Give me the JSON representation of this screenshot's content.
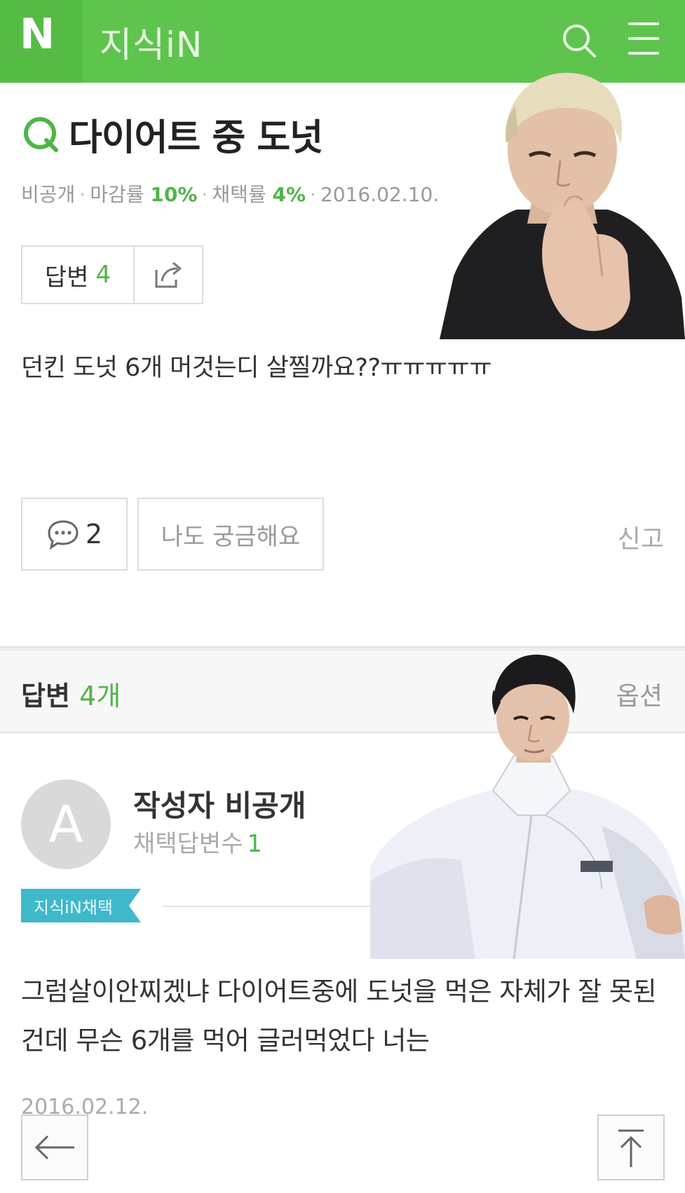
{
  "header": {
    "logo": "N",
    "title": "지식iN",
    "icons": [
      "search-icon",
      "menu-icon"
    ],
    "color": "#5ec44e"
  },
  "question": {
    "title": "다이어트 중 도넛",
    "meta": {
      "visibility": "비공개",
      "close_rate_label": "마감률",
      "close_rate": "10%",
      "accept_rate_label": "채택률",
      "accept_rate": "4%",
      "date": "2016.02.10."
    },
    "answers_label": "답변",
    "answers_count": "4",
    "body": "던킨 도넛 6개 머것는디 살찔까요??ㅠㅠㅠㅠㅠ",
    "comment_count": "2",
    "curious_label": "나도 궁금해요",
    "report_label": "신고"
  },
  "answers_section": {
    "label": "답변",
    "count": "4개",
    "options_label": "옵션"
  },
  "answer": {
    "avatar_letter": "A",
    "author": "작성자 비공개",
    "accepted_label": "채택답변수",
    "accepted_count": "1",
    "badge": "지식iN채택",
    "body": "그럼살이안찌겠냐 다이어트중에 도넛을 먹은 자체가 잘 못된건데 무슨 6개를 먹어 글러먹었다 너는",
    "date": "2016.02.12."
  },
  "accent": "#4fb548"
}
